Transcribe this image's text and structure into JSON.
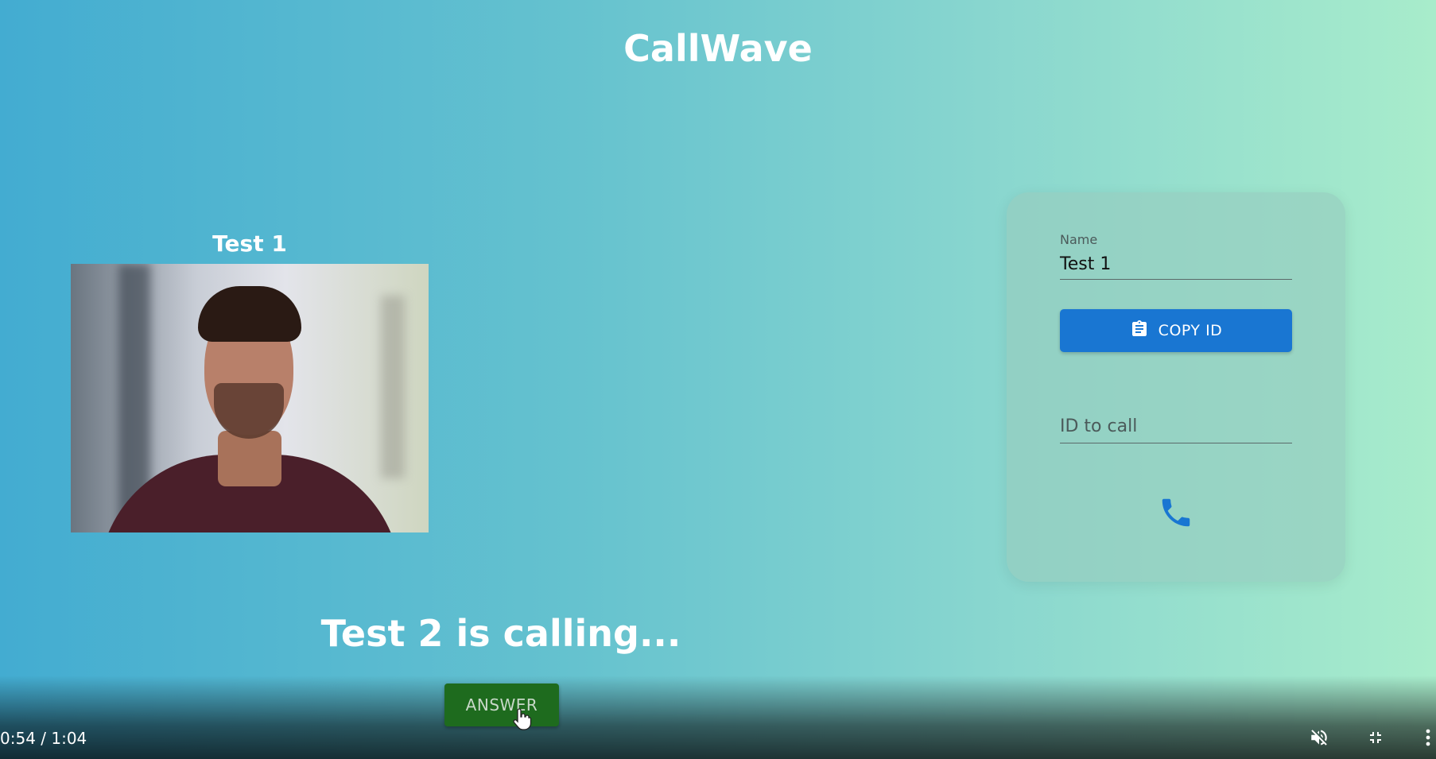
{
  "app": {
    "title": "CallWave"
  },
  "video": {
    "name": "Test 1"
  },
  "card": {
    "name_label": "Name",
    "name_value": "Test 1",
    "copy_label": "COPY ID",
    "call_placeholder": "ID to call"
  },
  "incoming": {
    "message": "Test 2 is calling...",
    "answer_label": "ANSWER"
  },
  "player": {
    "time": "0:54 / 1:04"
  },
  "icons": {
    "copy": "clipboard-icon",
    "call": "phone-icon",
    "mute": "volume-off-icon",
    "fullscreen": "fullscreen-exit-icon",
    "more": "more-vert-icon"
  },
  "colors": {
    "primary": "#1976d2",
    "answer": "#1e6b1e"
  }
}
